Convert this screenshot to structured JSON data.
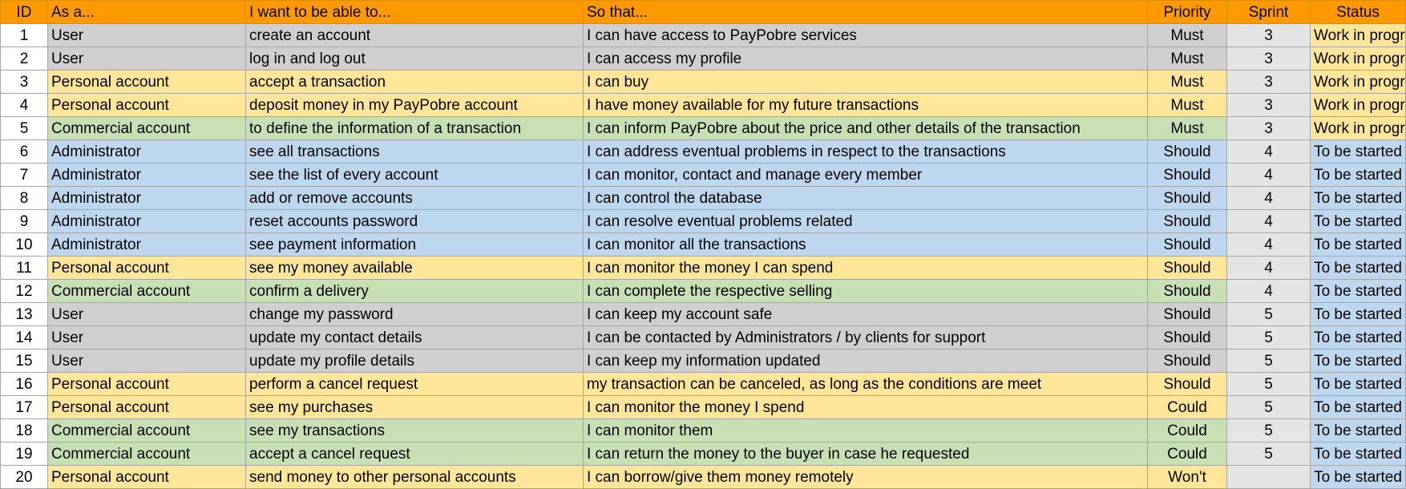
{
  "header": {
    "id": "ID",
    "role": "As a...",
    "want": "I want to be able to...",
    "so": "So that...",
    "priority": "Priority",
    "sprint": "Sprint",
    "status": "Status"
  },
  "colors": {
    "header": "#ff9900",
    "user": "#d0cece",
    "personal": "#ffe699",
    "commercial": "#c6e0b4",
    "admin": "#bdd7ee",
    "sprint_column": "#e4e4e4",
    "status_work_in_progress": "#ffe699",
    "status_to_be_started": "#bdd7ee"
  },
  "rows": [
    {
      "id": "1",
      "role": "User",
      "want": "create an account",
      "so": "I can have access to PayPobre services",
      "priority": "Must",
      "sprint": "3",
      "status": "Work in progress"
    },
    {
      "id": "2",
      "role": "User",
      "want": "log in and log out",
      "so": "I can access my profile",
      "priority": "Must",
      "sprint": "3",
      "status": "Work in progress"
    },
    {
      "id": "3",
      "role": "Personal account",
      "want": "accept a transaction",
      "so": "I can buy",
      "priority": "Must",
      "sprint": "3",
      "status": "Work in progress"
    },
    {
      "id": "4",
      "role": "Personal account",
      "want": "deposit money in my PayPobre account",
      "so": "I have money available for my future transactions",
      "priority": "Must",
      "sprint": "3",
      "status": "Work in progress"
    },
    {
      "id": "5",
      "role": "Commercial account",
      "want": "to define the information of a transaction",
      "so": "I can inform PayPobre about the price and other details of the transaction",
      "priority": "Must",
      "sprint": "3",
      "status": "Work in progress"
    },
    {
      "id": "6",
      "role": "Administrator",
      "want": "see all transactions",
      "so": "I can address eventual problems in respect to the transactions",
      "priority": "Should",
      "sprint": "4",
      "status": "To be started"
    },
    {
      "id": "7",
      "role": "Administrator",
      "want": "see the list of every account",
      "so": "I can monitor, contact and manage every member",
      "priority": "Should",
      "sprint": "4",
      "status": "To be started"
    },
    {
      "id": "8",
      "role": "Administrator",
      "want": "add or remove accounts",
      "so": "I can control the database",
      "priority": "Should",
      "sprint": "4",
      "status": "To be started"
    },
    {
      "id": "9",
      "role": "Administrator",
      "want": "reset accounts password",
      "so": "I can resolve eventual problems related",
      "priority": "Should",
      "sprint": "4",
      "status": "To be started"
    },
    {
      "id": "10",
      "role": "Administrator",
      "want": "see payment information",
      "so": "I can monitor all the transactions",
      "priority": "Should",
      "sprint": "4",
      "status": "To be started"
    },
    {
      "id": "11",
      "role": "Personal account",
      "want": "see my money available",
      "so": "I can monitor the money I can spend",
      "priority": "Should",
      "sprint": "4",
      "status": "To be started"
    },
    {
      "id": "12",
      "role": "Commercial account",
      "want": "confirm a delivery",
      "so": "I can complete the respective selling",
      "priority": "Should",
      "sprint": "4",
      "status": "To be started"
    },
    {
      "id": "13",
      "role": "User",
      "want": "change my password",
      "so": "I can keep my account safe",
      "priority": "Should",
      "sprint": "5",
      "status": "To be started"
    },
    {
      "id": "14",
      "role": "User",
      "want": "update my contact details",
      "so": "I can be contacted by Administrators / by clients for support",
      "priority": "Should",
      "sprint": "5",
      "status": "To be started"
    },
    {
      "id": "15",
      "role": "User",
      "want": "update my profile details",
      "so": "I can keep my information updated",
      "priority": "Should",
      "sprint": "5",
      "status": "To be started"
    },
    {
      "id": "16",
      "role": "Personal account",
      "want": "perform a cancel request",
      "so": "my transaction can be canceled, as long as the conditions are meet",
      "priority": "Should",
      "sprint": "5",
      "status": "To be started"
    },
    {
      "id": "17",
      "role": "Personal account",
      "want": "see my purchases",
      "so": "I can monitor the money I spend",
      "priority": "Could",
      "sprint": "5",
      "status": "To be started"
    },
    {
      "id": "18",
      "role": "Commercial account",
      "want": "see my transactions",
      "so": "I can monitor them",
      "priority": "Could",
      "sprint": "5",
      "status": "To be started"
    },
    {
      "id": "19",
      "role": "Commercial account",
      "want": "accept a cancel request",
      "so": "I can return the money to the buyer in case he requested",
      "priority": "Could",
      "sprint": "5",
      "status": "To be started"
    },
    {
      "id": "20",
      "role": "Personal account",
      "want": "send money to other personal accounts",
      "so": "I can borrow/give them money remotely",
      "priority": "Won't",
      "sprint": "",
      "status": "To be started"
    }
  ]
}
